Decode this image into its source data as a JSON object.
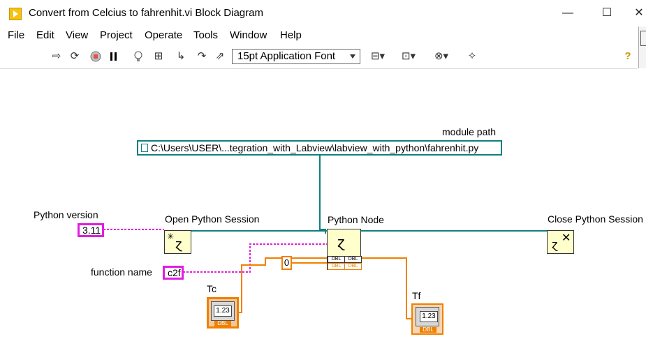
{
  "window": {
    "title": "Convert from Celcius to fahrenhit.vi Block Diagram",
    "controls": {
      "minimize": "—",
      "maximize": "☐",
      "close": "✕"
    }
  },
  "menu": {
    "items": [
      "File",
      "Edit",
      "View",
      "Project",
      "Operate",
      "Tools",
      "Window",
      "Help"
    ]
  },
  "toolbar": {
    "font_selector": "15pt Application Font",
    "icons": [
      "run-arrow-icon",
      "run-continuously-icon",
      "abort-icon",
      "pause-icon",
      "highlight-execution-icon",
      "retain-wire-values-icon",
      "step-into-icon",
      "step-over-icon",
      "step-out-icon",
      "align-objects-icon",
      "distribute-objects-icon",
      "reorder-icon",
      "cleanup-diagram-icon",
      "context-help-icon"
    ]
  },
  "diagram": {
    "module_path": {
      "label": "module path",
      "value": "C:\\Users\\USER\\...tegration_with_Labview\\labview_with_python\\fahrenhit.py"
    },
    "python_version": {
      "label": "Python version",
      "value": "3.11"
    },
    "function_name": {
      "label": "function name",
      "value": "c2f"
    },
    "open_session": {
      "label": "Open Python Session"
    },
    "python_node": {
      "label": "Python Node",
      "dbl_tag": "DBL"
    },
    "close_session": {
      "label": "Close Python Session"
    },
    "zero_constant": {
      "value": "0"
    },
    "tc": {
      "label": "Tc",
      "value": "1.23",
      "type": "DBL"
    },
    "tf": {
      "label": "Tf",
      "value": "1.23",
      "type": "DBL"
    },
    "colors": {
      "string_wire": "#e11ee1",
      "path_wire": "#0f7f7f",
      "numeric_wire": "#f08000",
      "function_bg": "#ffffcc"
    }
  }
}
